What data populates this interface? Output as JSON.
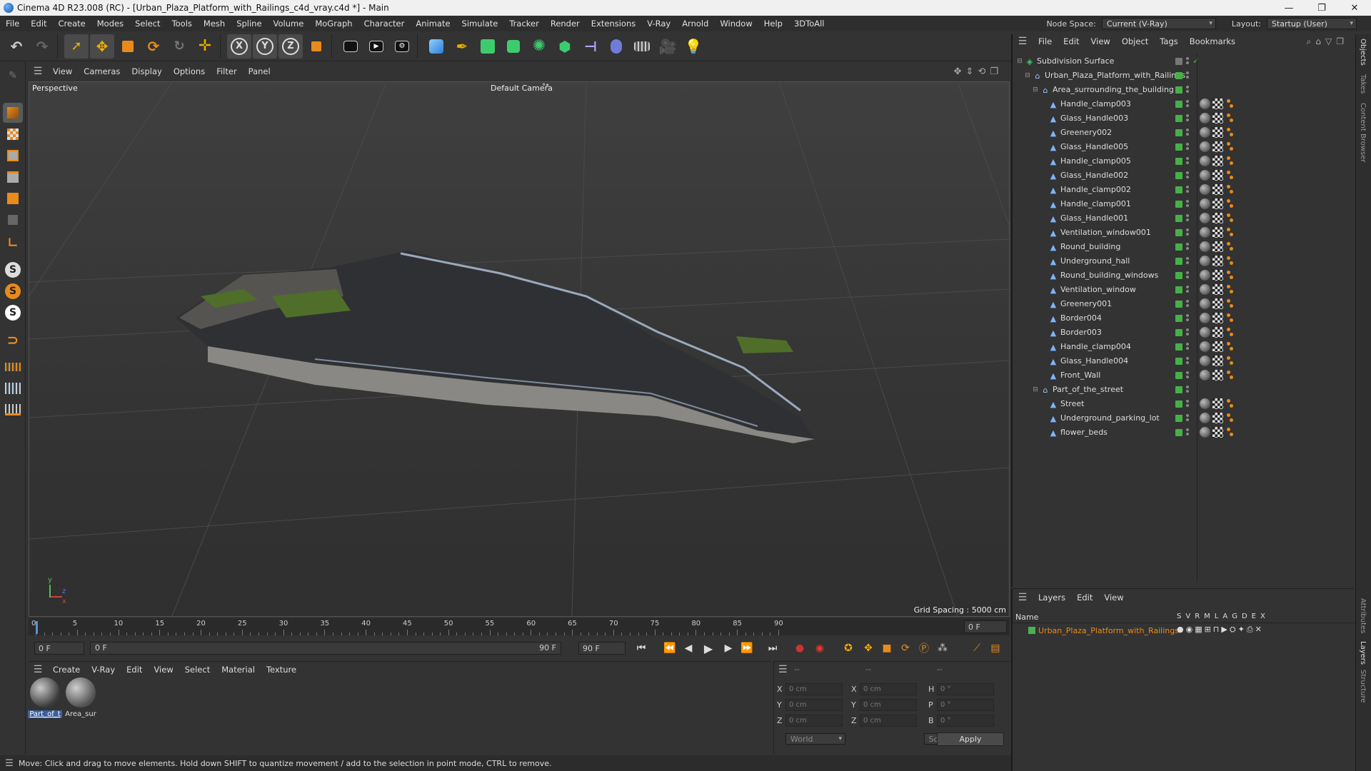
{
  "window": {
    "title": "Cinema 4D R23.008 (RC) - [Urban_Plaza_Platform_with_Railings_c4d_vray.c4d *] - Main",
    "buttons": [
      "—",
      "❐",
      "✕"
    ]
  },
  "menu": {
    "items": [
      "File",
      "Edit",
      "Create",
      "Modes",
      "Select",
      "Tools",
      "Mesh",
      "Spline",
      "Volume",
      "MoGraph",
      "Character",
      "Animate",
      "Simulate",
      "Tracker",
      "Render",
      "Extensions",
      "V-Ray",
      "Arnold",
      "Window",
      "Help",
      "3DToAll"
    ],
    "node_space_label": "Node Space:",
    "node_space_value": "Current (V-Ray)",
    "layout_label": "Layout:",
    "layout_value": "Startup (User)"
  },
  "viewport": {
    "menu": [
      "View",
      "Cameras",
      "Display",
      "Options",
      "Filter",
      "Panel"
    ],
    "view_name": "Perspective",
    "camera": "Default Camera",
    "camera_suffix": "°*",
    "grid_spacing": "Grid Spacing : 5000 cm",
    "axis": {
      "y": "y",
      "z": "z",
      "x": "x"
    }
  },
  "timeline": {
    "ticks": [
      "0",
      "5",
      "10",
      "15",
      "20",
      "25",
      "30",
      "35",
      "40",
      "45",
      "50",
      "55",
      "60",
      "65",
      "70",
      "75",
      "80",
      "85",
      "90"
    ],
    "end_field": "0 F",
    "current_frame": 0,
    "max_frame": 90
  },
  "transport": {
    "start": "0 F",
    "range_start": "0 F",
    "range_end": "90 F",
    "end": "90 F"
  },
  "materials": {
    "menu": [
      "Create",
      "V-Ray",
      "Edit",
      "View",
      "Select",
      "Material",
      "Texture"
    ],
    "items": [
      {
        "label": "Part_of_t",
        "selected": true
      },
      {
        "label": "Area_sur",
        "selected": false
      }
    ]
  },
  "coords": {
    "headers": [
      "--",
      "--",
      "--"
    ],
    "rows": [
      {
        "a": "X",
        "av": "0 cm",
        "b": "X",
        "bv": "0 cm",
        "c": "H",
        "cv": "0 °"
      },
      {
        "a": "Y",
        "av": "0 cm",
        "b": "Y",
        "bv": "0 cm",
        "c": "P",
        "cv": "0 °"
      },
      {
        "a": "Z",
        "av": "0 cm",
        "b": "Z",
        "bv": "0 cm",
        "c": "B",
        "cv": "0 °"
      }
    ],
    "mode": "World",
    "scale": "Scale",
    "apply": "Apply"
  },
  "status": "Move: Click and drag to move elements. Hold down SHIFT to quantize movement / add to the selection in point mode, CTRL to remove.",
  "objects": {
    "menu": [
      "File",
      "Edit",
      "View",
      "Object",
      "Tags",
      "Bookmarks"
    ],
    "rows": [
      {
        "name": "Subdivision Surface",
        "level": 0,
        "kind": "subd"
      },
      {
        "name": "Urban_Plaza_Platform_with_Railings",
        "level": 1,
        "kind": "null"
      },
      {
        "name": "Area_surrounding_the_building",
        "level": 2,
        "kind": "null"
      },
      {
        "name": "Handle_clamp003",
        "level": 3,
        "kind": "mesh"
      },
      {
        "name": "Glass_Handle003",
        "level": 3,
        "kind": "mesh"
      },
      {
        "name": "Greenery002",
        "level": 3,
        "kind": "mesh"
      },
      {
        "name": "Glass_Handle005",
        "level": 3,
        "kind": "mesh"
      },
      {
        "name": "Handle_clamp005",
        "level": 3,
        "kind": "mesh"
      },
      {
        "name": "Glass_Handle002",
        "level": 3,
        "kind": "mesh"
      },
      {
        "name": "Handle_clamp002",
        "level": 3,
        "kind": "mesh"
      },
      {
        "name": "Handle_clamp001",
        "level": 3,
        "kind": "mesh"
      },
      {
        "name": "Glass_Handle001",
        "level": 3,
        "kind": "mesh"
      },
      {
        "name": "Ventilation_window001",
        "level": 3,
        "kind": "mesh"
      },
      {
        "name": "Round_building",
        "level": 3,
        "kind": "mesh"
      },
      {
        "name": "Underground_hall",
        "level": 3,
        "kind": "mesh"
      },
      {
        "name": "Round_building_windows",
        "level": 3,
        "kind": "mesh"
      },
      {
        "name": "Ventilation_window",
        "level": 3,
        "kind": "mesh"
      },
      {
        "name": "Greenery001",
        "level": 3,
        "kind": "mesh"
      },
      {
        "name": "Border004",
        "level": 3,
        "kind": "mesh"
      },
      {
        "name": "Border003",
        "level": 3,
        "kind": "mesh"
      },
      {
        "name": "Handle_clamp004",
        "level": 3,
        "kind": "mesh"
      },
      {
        "name": "Glass_Handle004",
        "level": 3,
        "kind": "mesh"
      },
      {
        "name": "Front_Wall",
        "level": 3,
        "kind": "mesh"
      },
      {
        "name": "Part_of_the_street",
        "level": 2,
        "kind": "null"
      },
      {
        "name": "Street",
        "level": 3,
        "kind": "mesh"
      },
      {
        "name": "Underground_parking_lot",
        "level": 3,
        "kind": "mesh"
      },
      {
        "name": "flower_beds",
        "level": 3,
        "kind": "mesh"
      }
    ]
  },
  "layers": {
    "menu": [
      "Layers",
      "Edit",
      "View"
    ],
    "name_header": "Name",
    "flag_headers": [
      "S",
      "V",
      "R",
      "M",
      "L",
      "A",
      "G",
      "D",
      "E",
      "X"
    ],
    "rows": [
      {
        "name": "Urban_Plaza_Platform_with_Railings",
        "color": "#4caf50"
      }
    ]
  },
  "side_tabs": [
    "Objects",
    "Takes",
    "Content Browser",
    "Attributes",
    "Layers",
    "Structure"
  ],
  "colors": {
    "accent": "#e88b1c",
    "active_green": "#45b145",
    "layer_name": "#e88b1c"
  }
}
